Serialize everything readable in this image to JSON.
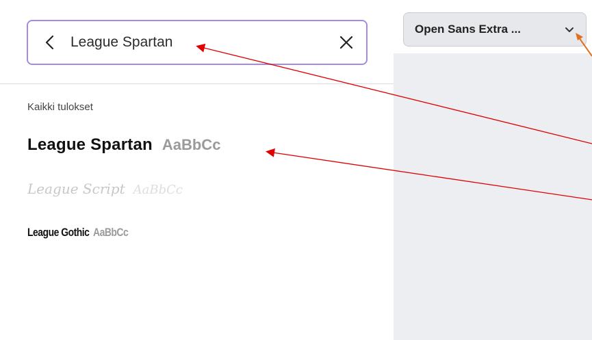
{
  "search": {
    "value": "League Spartan",
    "back_icon": "chevron-left-icon",
    "clear_icon": "close-icon"
  },
  "results": {
    "section_title": "Kaikki tulokset",
    "items": [
      {
        "name": "League Spartan",
        "sample": "AaBbCc"
      },
      {
        "name": "League Script",
        "sample": "AaBbCc"
      },
      {
        "name": "League Gothic",
        "sample": "AaBbCc"
      }
    ]
  },
  "toolbar": {
    "font_label": "Open Sans Extra ...",
    "chevron_icon": "chevron-down-icon"
  },
  "colors": {
    "accent_border": "#a48ae6",
    "annotation_arrow": "#e00000",
    "cursor_arrow": "#e07020",
    "right_panel_bg": "#eceef1"
  }
}
